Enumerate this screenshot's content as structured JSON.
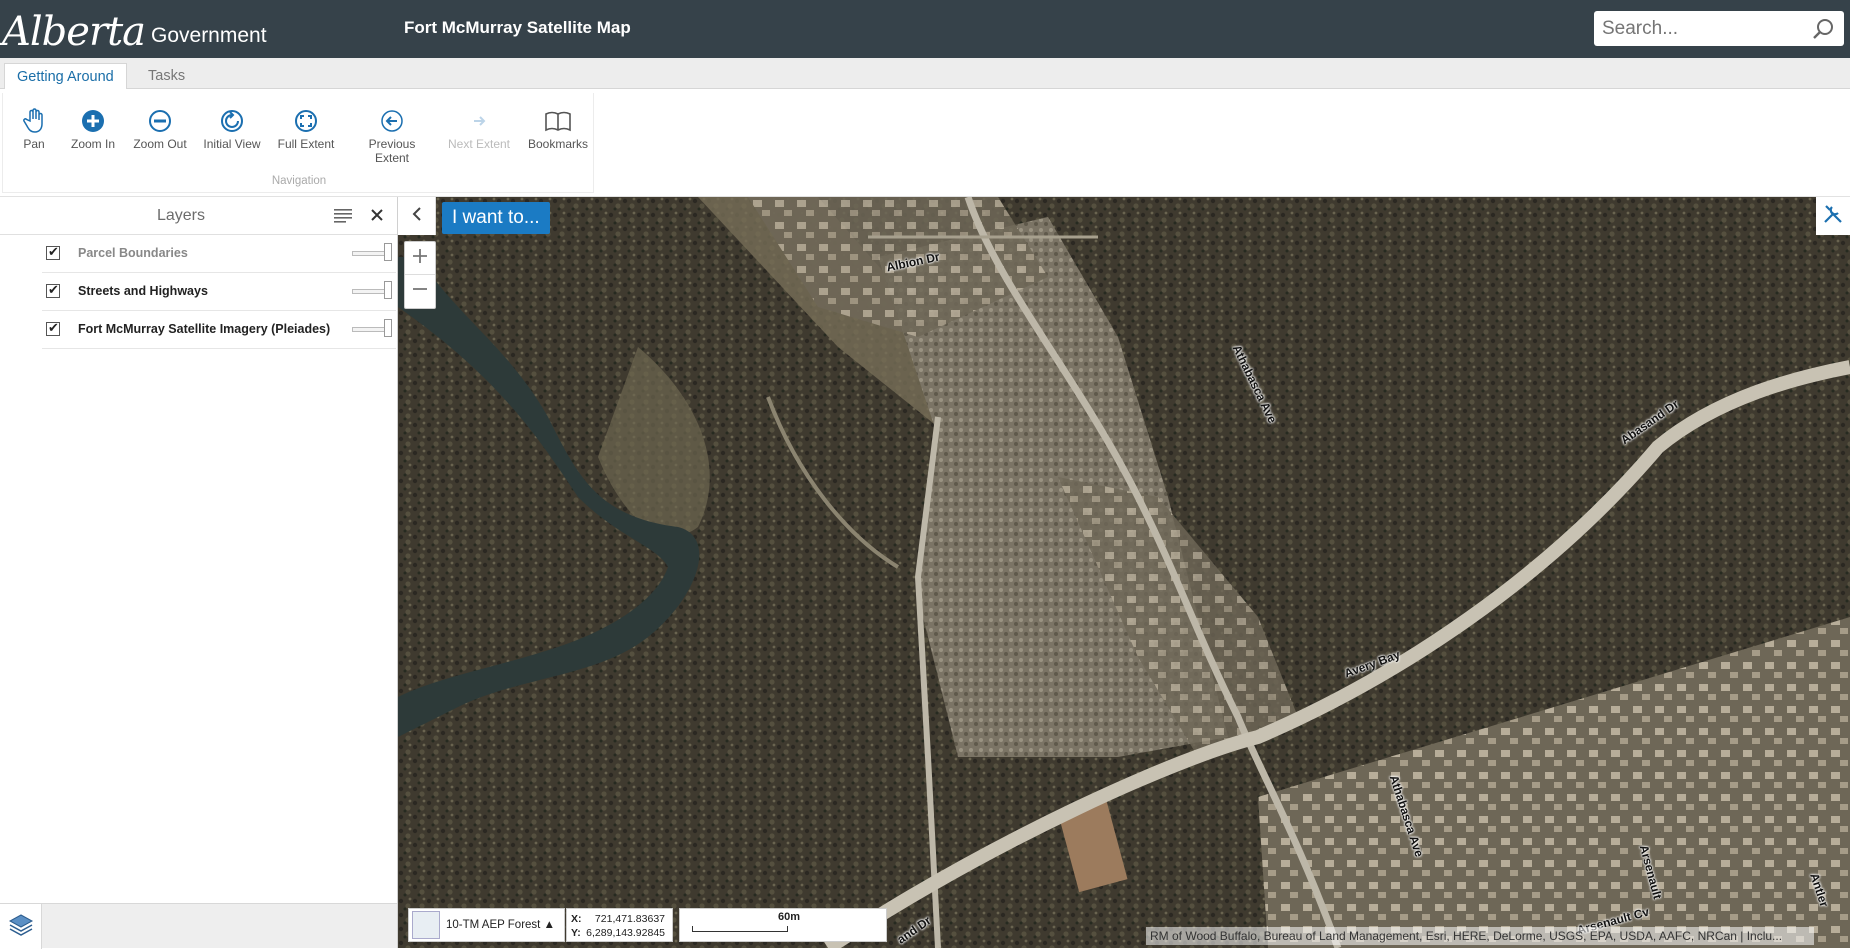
{
  "header": {
    "logo_script": "Alberta",
    "logo_text": "Government",
    "title": "Fort McMurray Satellite Map",
    "search_placeholder": "Search..."
  },
  "tabs": [
    {
      "label": "Getting Around",
      "active": true
    },
    {
      "label": "Tasks",
      "active": false
    }
  ],
  "ribbon": {
    "group_label": "Navigation",
    "tools": [
      {
        "label": "Pan",
        "icon": "hand-icon"
      },
      {
        "label": "Zoom In",
        "icon": "plus-circle-icon"
      },
      {
        "label": "Zoom Out",
        "icon": "minus-circle-icon"
      },
      {
        "label": "Initial View",
        "icon": "refresh-icon"
      },
      {
        "label": "Full Extent",
        "icon": "expand-icon"
      },
      {
        "label": "Previous Extent",
        "icon": "arrow-left-icon"
      },
      {
        "label": "Next Extent",
        "icon": "arrow-right-icon",
        "disabled": true
      },
      {
        "label": "Bookmarks",
        "icon": "book-icon"
      }
    ]
  },
  "layers": {
    "title": "Layers",
    "items": [
      {
        "label": "Parcel Boundaries",
        "checked": true,
        "dimmed": true
      },
      {
        "label": "Streets and Highways",
        "checked": true,
        "dimmed": false
      },
      {
        "label": "Fort McMurray Satellite Imagery (Pleiades)",
        "checked": true,
        "dimmed": false
      }
    ]
  },
  "map": {
    "i_want_to": "I want to...",
    "basemap_label": "10-TM AEP Forest ▲",
    "coords": {
      "x_label": "X:",
      "x": "721,471.83637",
      "y_label": "Y:",
      "y": "6,289,143.92845"
    },
    "scale_label": "60m",
    "attribution": "RM of Wood Buffalo, Bureau of Land Management, Esri, HERE, DeLorme, USGS, EPA, USDA, AAFC, NRCan | Inclu...",
    "road_labels": [
      "Albion Dr",
      "Athabasca Ave",
      "Abasand Dr",
      "Avery Bay",
      "Athabasca Ave",
      "Arsenault Cv",
      "Arsenault",
      "and Dr",
      "Antler"
    ]
  },
  "colors": {
    "header_bg": "#36424a",
    "accent": "#1b7bc4",
    "tab_active": "#1a6ea8"
  }
}
